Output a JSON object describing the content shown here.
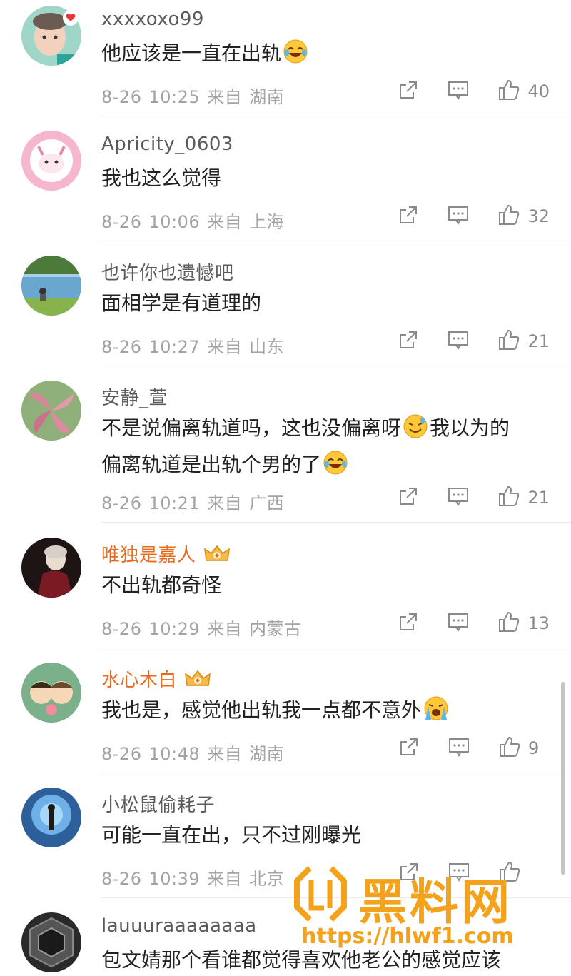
{
  "comments": [
    {
      "username": "xxxxoxo99",
      "vip": false,
      "text": "他应该是一直在出轨",
      "emoji": "laugh-cry",
      "date": "8-26",
      "time": "10:25",
      "from": "来自",
      "location": "湖南",
      "likes": "40",
      "avatar_bg": "#a8d8cf"
    },
    {
      "username": "Apricity_0603",
      "vip": false,
      "text": "我也这么觉得",
      "emoji": "",
      "date": "8-26",
      "time": "10:06",
      "from": "来自",
      "location": "上海",
      "likes": "32",
      "avatar_bg": "#f3a6c3"
    },
    {
      "username": "也许你也遗憾吧",
      "vip": false,
      "text": "面相学是有道理的",
      "emoji": "",
      "date": "8-26",
      "time": "10:27",
      "from": "来自",
      "location": "山东",
      "likes": "21",
      "avatar_bg": "#6aa1c4"
    },
    {
      "username": "安静_萱",
      "vip": false,
      "text": "不是说偏离轨道吗，这也没偏离呀",
      "text2": "我以为的",
      "line2": "偏离轨道是出轨个男的了",
      "emoji": "sweat-laugh",
      "emoji2": "laugh-cry",
      "date": "8-26",
      "time": "10:21",
      "from": "来自",
      "location": "广西",
      "likes": "21",
      "avatar_bg": "#c97a8e"
    },
    {
      "username": "唯独是嘉人",
      "vip": true,
      "text": "不出轨都奇怪",
      "emoji": "",
      "date": "8-26",
      "time": "10:29",
      "from": "来自",
      "location": "内蒙古",
      "likes": "13",
      "avatar_bg": "#2a1a1a"
    },
    {
      "username": "水心木白",
      "vip": true,
      "text": "我也是，感觉他出轨我一点都不意外",
      "emoji": "crying",
      "date": "8-26",
      "time": "10:48",
      "from": "来自",
      "location": "湖南",
      "likes": "9",
      "avatar_bg": "#7fb48a"
    },
    {
      "username": "小松鼠偷耗子",
      "vip": false,
      "text": "可能一直在出，只不过刚曝光",
      "emoji": "",
      "date": "8-26",
      "time": "10:39",
      "from": "来自",
      "location": "北京",
      "likes": "",
      "avatar_bg": "#4a7fb8"
    },
    {
      "username": "lauuuraaaaaaaa",
      "vip": false,
      "text": "包文婧那个看谁都觉得喜欢他老公的感觉应该",
      "emoji": "",
      "date": "",
      "time": "",
      "from": "",
      "location": "",
      "likes": "",
      "avatar_bg": "#3a3a3a"
    }
  ],
  "watermark": {
    "title": "黑料网",
    "url": "https://hlwf1.com",
    "color": "#f4a21b"
  },
  "colors": {
    "vip_name": "#e86b1f",
    "meta": "#a3a3a3",
    "icon": "#8a8a8a"
  }
}
